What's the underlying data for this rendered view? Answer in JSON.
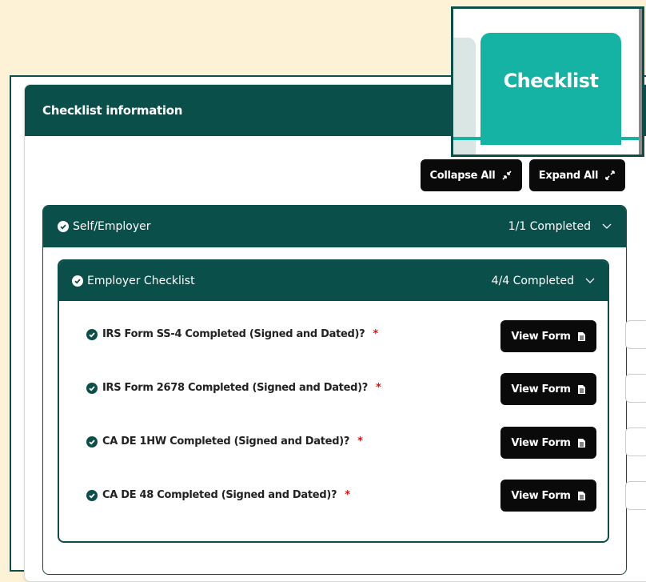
{
  "card": {
    "title": "Checklist information"
  },
  "toolbar": {
    "collapse_label": "Collapse All",
    "expand_label": "Expand All"
  },
  "section": {
    "title": "Self/Employer",
    "status": "1/1 Completed",
    "checklist": {
      "title": "Employer Checklist",
      "status": "4/4 Completed",
      "items": [
        {
          "label": "IRS Form SS-4 Completed (Signed and Dated)?",
          "required": "*",
          "button": "View Form"
        },
        {
          "label": "IRS Form 2678 Completed (Signed and Dated)?",
          "required": "*",
          "button": "View Form"
        },
        {
          "label": "CA DE 1HW Completed (Signed and Dated)?",
          "required": "*",
          "button": "View Form"
        },
        {
          "label": "CA DE 48 Completed (Signed and Dated)?",
          "required": "*",
          "button": "View Form"
        }
      ]
    }
  },
  "inset": {
    "tab_label": "Checklist"
  },
  "colors": {
    "primary": "#0b4f4a",
    "accent": "#14b3a4",
    "required": "#dd1111",
    "background": "#fdf1d6"
  },
  "icons": {
    "check": "check-circle-icon",
    "chevron": "chevron-down-icon",
    "document": "document-icon",
    "collapse": "collapse-arrows-icon",
    "expand": "expand-arrows-icon"
  }
}
